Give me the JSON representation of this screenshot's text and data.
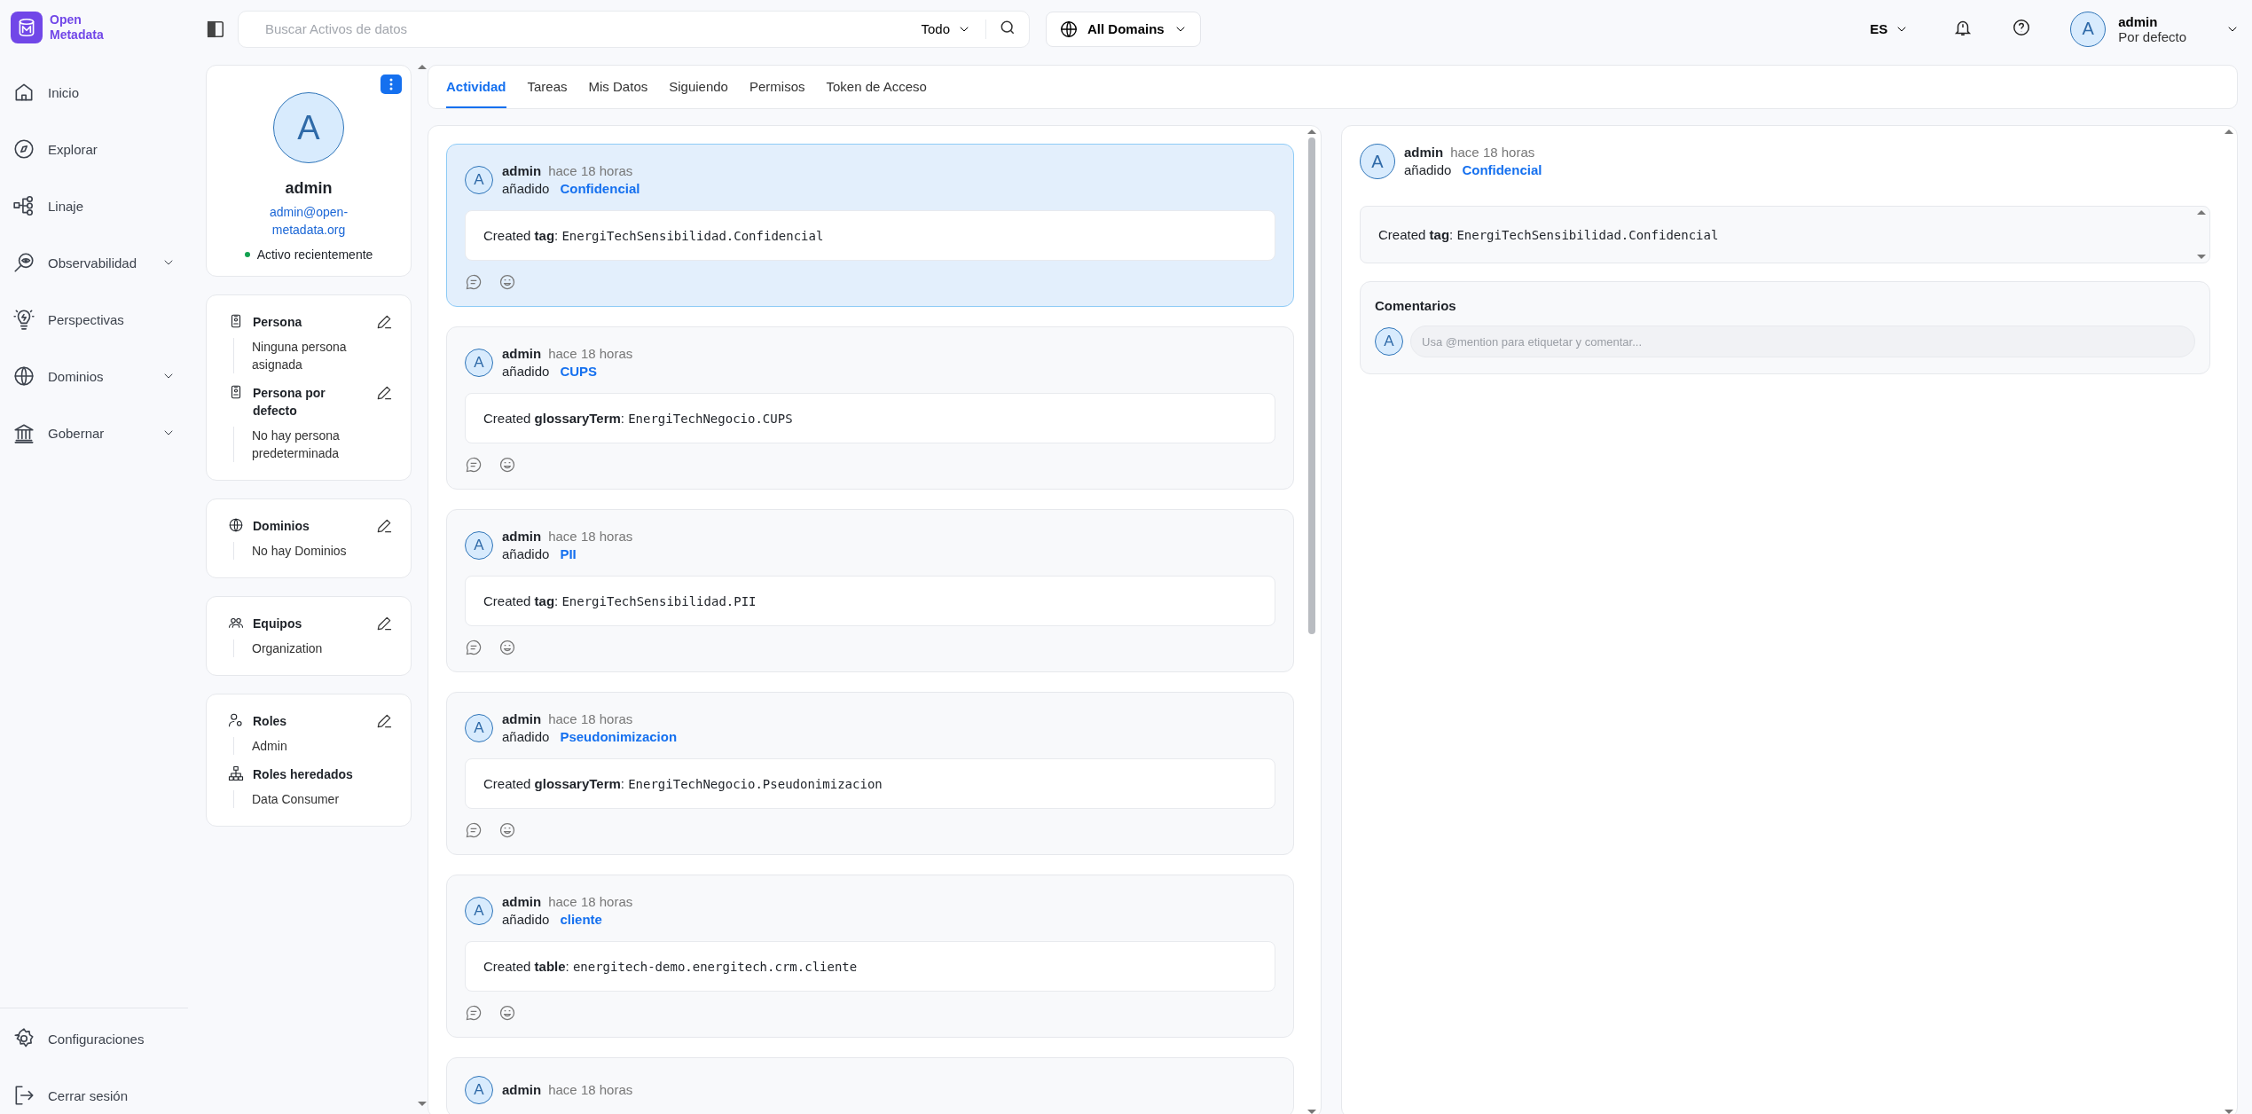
{
  "logo": {
    "line1": "Open",
    "line2": "Metadata"
  },
  "sidebar": {
    "items": [
      {
        "label": "Inicio",
        "expandable": false
      },
      {
        "label": "Explorar",
        "expandable": false
      },
      {
        "label": "Linaje",
        "expandable": false
      },
      {
        "label": "Observabilidad",
        "expandable": true
      },
      {
        "label": "Perspectivas",
        "expandable": false
      },
      {
        "label": "Dominios",
        "expandable": true
      },
      {
        "label": "Gobernar",
        "expandable": true
      }
    ],
    "bottom_items": [
      {
        "label": "Configuraciones"
      },
      {
        "label": "Cerrar sesión"
      }
    ]
  },
  "top_bar": {
    "search": {
      "placeholder": "Buscar Activos de datos",
      "filter": "Todo"
    },
    "domain_selector": "All Domains",
    "language": "ES",
    "user": {
      "avatar": "A",
      "name": "admin",
      "role": "Por defecto"
    }
  },
  "profile": {
    "avatar": "A",
    "name": "admin",
    "email": "admin@open-metadata.org",
    "status": "Activo recientemente",
    "online": true,
    "cards": [
      {
        "sections": [
          {
            "title": "Persona",
            "values": [
              "Ninguna persona asignada"
            ],
            "editable": true
          },
          {
            "title": "Persona por defecto",
            "values": [
              "No hay persona predeterminada"
            ],
            "editable": true
          }
        ]
      },
      {
        "sections": [
          {
            "title": "Dominios",
            "values": [
              "No hay Dominios"
            ],
            "editable": true
          }
        ]
      },
      {
        "sections": [
          {
            "title": "Equipos",
            "values": [
              "Organization"
            ],
            "editable": true
          }
        ]
      },
      {
        "sections": [
          {
            "title": "Roles",
            "values": [
              "Admin"
            ],
            "editable": true
          },
          {
            "title": "Roles heredados",
            "values": [
              "Data Consumer"
            ],
            "editable": false
          }
        ]
      }
    ]
  },
  "tabs": [
    {
      "label": "Actividad",
      "selected": true
    },
    {
      "label": "Tareas",
      "selected": false
    },
    {
      "label": "Mis Datos",
      "selected": false
    },
    {
      "label": "Siguiendo",
      "selected": false
    },
    {
      "label": "Permisos",
      "selected": false
    },
    {
      "label": "Token de Acceso",
      "selected": false
    }
  ],
  "feed": [
    {
      "avatar": "A",
      "user": "admin",
      "time": "hace 18 horas",
      "action": "añadido",
      "entity": "Confidencial",
      "message": "Created **tag**:",
      "fqn": "EnergiTechSensibilidad.Confidencial",
      "selected": true
    },
    {
      "avatar": "A",
      "user": "admin",
      "time": "hace 18 horas",
      "action": "añadido",
      "entity": "CUPS",
      "message": "Created **glossaryTerm**:",
      "fqn": "EnergiTechNegocio.CUPS",
      "selected": false
    },
    {
      "avatar": "A",
      "user": "admin",
      "time": "hace 18 horas",
      "action": "añadido",
      "entity": "PII",
      "message": "Created **tag**:",
      "fqn": "EnergiTechSensibilidad.PII",
      "selected": false
    },
    {
      "avatar": "A",
      "user": "admin",
      "time": "hace 18 horas",
      "action": "añadido",
      "entity": "Pseudonimizacion",
      "message": "Created **glossaryTerm**:",
      "fqn": "EnergiTechNegocio.Pseudonimizacion",
      "selected": false
    },
    {
      "avatar": "A",
      "user": "admin",
      "time": "hace 18 horas",
      "action": "añadido",
      "entity": "cliente",
      "message": "Created **table**:",
      "fqn": "energitech-demo.energitech.crm.cliente",
      "selected": false
    },
    {
      "avatar": "A",
      "user": "admin",
      "time": "hace 18 horas",
      "selected": false
    }
  ],
  "detail": {
    "avatar": "A",
    "user": "admin",
    "time": "hace 18 horas",
    "action": "añadido",
    "entity": "Confidencial",
    "message": "Created **tag**:",
    "fqn": "EnergiTechSensibilidad.Confidencial",
    "comments": {
      "title": "Comentarios",
      "avatar": "A",
      "placeholder": "Usa @mention para etiquetar y comentar..."
    }
  }
}
